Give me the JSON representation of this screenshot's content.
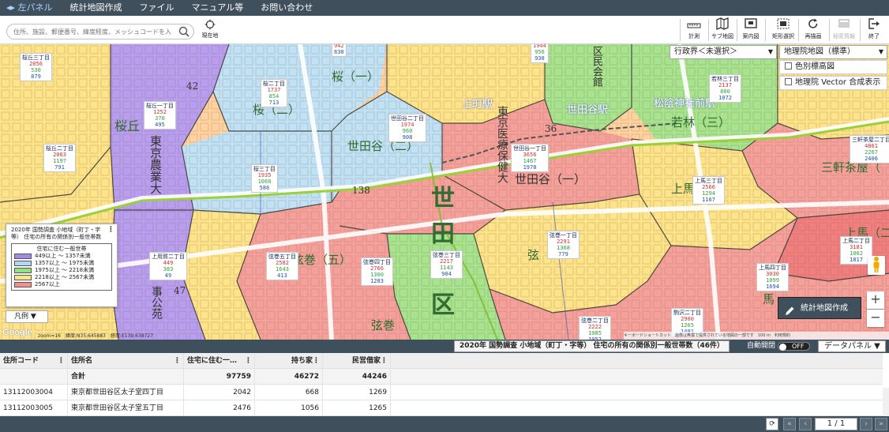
{
  "menubar": {
    "items": [
      "◂▸ 左パネル",
      "統計地図作成",
      "ファイル",
      "マニュアル等",
      "お問い合わせ"
    ]
  },
  "search": {
    "placeholder": "住所、施設、郵便番号、緯度経度、メッシュコードを入力"
  },
  "current_location": {
    "label": "現在地"
  },
  "tools": [
    {
      "label": "計測",
      "icon": "ruler-icon"
    },
    {
      "label": "サブ地図",
      "icon": "sub-map-icon"
    },
    {
      "label": "案内図",
      "icon": "overview-map-icon"
    },
    {
      "label": "矩形選択",
      "icon": "rectangle-select-icon"
    },
    {
      "label": "再描画",
      "icon": "refresh-icon"
    },
    {
      "label": "秘匿情報",
      "icon": "hidden-info-icon",
      "disabled": true
    },
    {
      "label": "終了",
      "icon": "exit-icon"
    }
  ],
  "map_controls": {
    "boundary_select": "行政界＜未選択＞",
    "basemap_select": "地理院地図（標準）",
    "relief_label": "色別標高図",
    "vector_label": "地理院 Vector 合成表示"
  },
  "map_labels": [
    "桜丘",
    "東京農業大",
    "桜（二）",
    "桜（一）",
    "世田谷（二）",
    "上町駅",
    "東京医療保健大",
    "世田谷（一）",
    "世田谷駅",
    "松陰神社前駅",
    "若林（三）",
    "三軒茶屋（",
    "上馬（",
    "上馬（二）",
    "世",
    "田",
    "区",
    "弦巻（五）",
    "弦巻",
    "弦",
    "馬",
    "事公苑",
    "区民会館",
    "42",
    "138",
    "36",
    "47"
  ],
  "areas": [
    {
      "name": "桜丘三丁目",
      "v1": "2056",
      "v2": "530",
      "v3": "879"
    },
    {
      "name": "桜丘二丁目",
      "v1": "2063",
      "v2": "1197",
      "v3": "791"
    },
    {
      "name": "桜丘一丁目",
      "v1": "1252",
      "v2": "370",
      "v3": "495"
    },
    {
      "name": "桜二丁目",
      "v1": "1737",
      "v2": "854",
      "v3": "713"
    },
    {
      "name": "桜三丁目",
      "v1": "1935",
      "v2": "1060",
      "v3": "586"
    },
    {
      "name": "世田谷二丁目",
      "v1": "1974",
      "v2": "960",
      "v3": "908"
    },
    {
      "name": "世田谷一丁目",
      "v1": "3656",
      "v2": "1467",
      "v3": "1978"
    },
    {
      "name": "若林三丁目",
      "v1": "2137",
      "v2": "800",
      "v3": "1072"
    },
    {
      "name": "三軒茶屋二丁目",
      "v1": "4861",
      "v2": "2267",
      "v3": "2406"
    },
    {
      "name": "上馬三丁目",
      "v1": "2566",
      "v2": "1294",
      "v3": "1167"
    },
    {
      "name": "上馬二丁目",
      "v1": "3181",
      "v2": "1062",
      "v3": "1817"
    },
    {
      "name": "上馬四丁目",
      "v1": "3030",
      "v2": "1099",
      "v3": "1694"
    },
    {
      "name": "弦巻一丁目",
      "v1": "2291",
      "v2": "1368",
      "v3": "779"
    },
    {
      "name": "弦巻三丁目",
      "v1": "2217",
      "v2": "1143",
      "v3": "904"
    },
    {
      "name": "弦巻四丁目",
      "v1": "2766",
      "v2": "1300",
      "v3": "1283"
    },
    {
      "name": "弦巻五丁目",
      "v1": "2582",
      "v2": "1643",
      "v3": "413"
    },
    {
      "name": "上用賀二丁目",
      "v1": "449",
      "v2": "383",
      "v3": "49"
    },
    {
      "name": "駒沢二丁目",
      "v1": "2900",
      "v2": "1265",
      "v3": "1491"
    },
    {
      "name": "弦巻二丁目",
      "v1": "2222",
      "v2": "1085",
      "v3": "1052"
    },
    {
      "name": "",
      "v1": "1944",
      "v2": "956",
      "v3": "930"
    },
    {
      "name": "",
      "v1": "942",
      "v2": "",
      "v3": "830"
    }
  ],
  "legend": {
    "title": "2020年 国勢調査 小地域（町丁・字等） 住宅の所有の関係別一般世帯数",
    "header": "住宅に住む一般世帯",
    "items": [
      {
        "label": "449以上 〜 1357未満",
        "color": "#a08be6"
      },
      {
        "label": "1357以上 〜 1975未満",
        "color": "#aed8f4"
      },
      {
        "label": "1975以上 〜 2218未満",
        "color": "#8fe37f"
      },
      {
        "label": "2218以上 〜 2567未満",
        "color": "#fde48a"
      },
      {
        "label": "2567以上",
        "color": "#f48f8f"
      }
    ],
    "toggle_label": "凡例 ▼"
  },
  "stats_button": "統計地図作成",
  "attribution": {
    "google": "Google",
    "scale": "zoom=16　緯度:N35.645883　経度:E139.638727",
    "text": "キーボードショートカット　画像は無償で提供されている地図の一部です　100 m　利用規約"
  },
  "data_panel": {
    "title": "2020年 国勢調査 小地域（町丁・字等） 住宅の所有の関係別一般世帯数（46件）",
    "auto_label": "自動開閉",
    "toggle": "OFF",
    "panel_button": "データパネル ▼",
    "columns": [
      "住所コード",
      "住所名",
      "住宅に住む一…",
      "持ち家",
      "民営借家"
    ],
    "total": {
      "label": "合計",
      "c3": "97759",
      "c4": "46272",
      "c5": "44246"
    },
    "rows": [
      {
        "code": "13112003004",
        "name": "東京都世田谷区太子堂四丁目",
        "c3": "2042",
        "c4": "668",
        "c5": "1269"
      },
      {
        "code": "13112003005",
        "name": "東京都世田谷区太子堂五丁目",
        "c3": "2476",
        "c4": "1056",
        "c5": "1265"
      }
    ]
  },
  "pagination": {
    "page": "1 / 1"
  }
}
